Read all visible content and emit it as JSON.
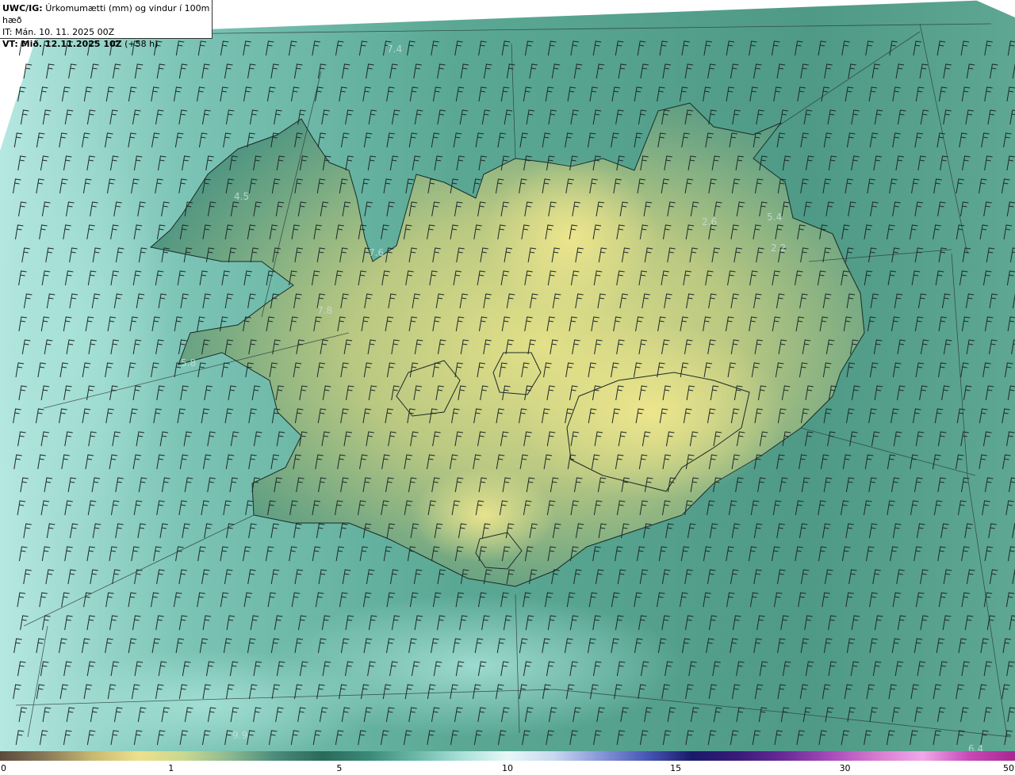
{
  "header": {
    "product_code": "UWC/IG:",
    "title": "Úrkomumætti (mm) og vindur í 100m hæð",
    "init_line": "IT: Mán. 10. 11. 2025 00Z",
    "valid_label": "VT: Mið. 12.11.2025 10Z",
    "valid_suffix": "(+58 h)"
  },
  "map_labels": [
    {
      "text": "7.4",
      "name": "value-label-north"
    },
    {
      "text": "4.5",
      "name": "value-label-westfjords"
    },
    {
      "text": "7.6",
      "name": "value-label-northwest"
    },
    {
      "text": "7.8",
      "name": "value-label-west"
    },
    {
      "text": "5.8",
      "name": "value-label-snaefellsnes"
    },
    {
      "text": "2.6",
      "name": "value-label-northeast"
    },
    {
      "text": "5.4",
      "name": "value-label-east-coast"
    },
    {
      "text": "2.2",
      "name": "value-label-east"
    },
    {
      "text": "9.9",
      "name": "value-label-southwest-sea"
    },
    {
      "text": "6.4",
      "name": "value-label-southeast-sea"
    }
  ],
  "colorbar": {
    "ticks": [
      "0",
      "1",
      "5",
      "10",
      "15",
      "30",
      "50"
    ],
    "colors": [
      "#5a4a3a",
      "#8a7a5a",
      "#c8b870",
      "#eee08a",
      "#c8d890",
      "#8ab890",
      "#4a8a7a",
      "#2a6a5a",
      "#3a8a7a",
      "#6ab8a8",
      "#a8e0d8",
      "#e8f8f8",
      "#c8d8f0",
      "#8898d8",
      "#4858b8",
      "#1a1a6a",
      "#3a1a7a",
      "#6a2a9a",
      "#a84aba",
      "#d87ad0",
      "#f0a8e8",
      "#c848b8",
      "#a82890"
    ]
  }
}
